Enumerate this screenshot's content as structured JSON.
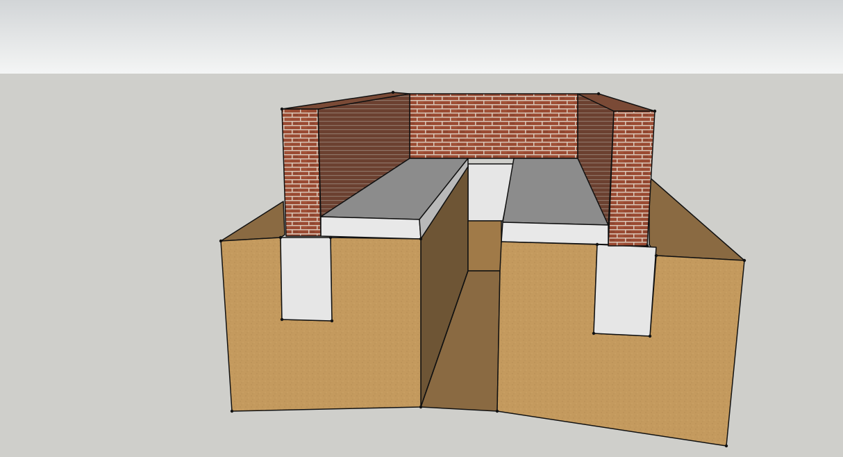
{
  "viewport": {
    "sky_colors": [
      "#d2d5d7",
      "#f4f5f5"
    ],
    "ground_color": "#cfcfcb"
  },
  "model": {
    "materials": {
      "soil": "#c49a5e",
      "soil_dark": "#8a6a42",
      "soil_shadow": "#6e5535",
      "brick": "#9a4a32",
      "brick_shadow": "#5e3a2a",
      "mortar": "#d9c7b8",
      "concrete_top": "#8c8c8c",
      "concrete_face": "#e8e8e8",
      "edge": "#111111"
    }
  }
}
